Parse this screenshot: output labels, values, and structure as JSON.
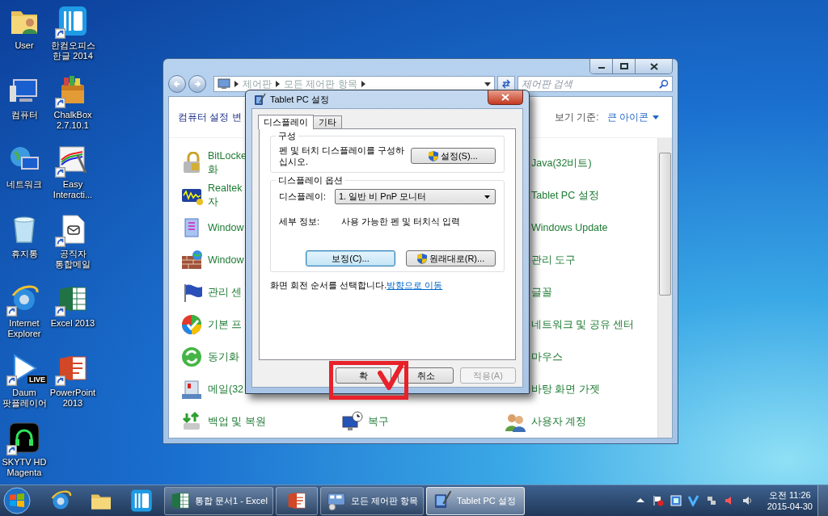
{
  "desktop_icons": [
    {
      "label": "User",
      "shortcut": false
    },
    {
      "label": "컴퓨터",
      "shortcut": false
    },
    {
      "label": "네트워크",
      "shortcut": false
    },
    {
      "label": "휴지통",
      "shortcut": false
    },
    {
      "label": "Internet Explorer",
      "shortcut": true
    },
    {
      "label": "Daum 팟플레이어",
      "shortcut": true,
      "badge": "LIVE"
    },
    {
      "label": "SKYTV HD Magenta",
      "shortcut": true
    },
    {
      "label": "한컴오피스 한글 2014",
      "shortcut": true
    },
    {
      "label": "ChalkBox 2.7.10.1",
      "shortcut": true
    },
    {
      "label": "Easy Interacti...",
      "shortcut": true
    },
    {
      "label": "공직자 통합메일",
      "shortcut": true
    },
    {
      "label": "Excel 2013",
      "shortcut": true
    },
    {
      "label": "PowerPoint 2013",
      "shortcut": true
    }
  ],
  "control_panel": {
    "breadcrumb": [
      "제어판",
      "모든 제어판 항목"
    ],
    "search": {
      "placeholder": "제어판 검색"
    },
    "heading": "컴퓨터 설정 변",
    "view_label": "보기 기준:",
    "view_value": "큰 아이콘",
    "rows": [
      {
        "left": "BitLocke\n화",
        "right": "Java(32비트)"
      },
      {
        "left": "Realtek\n자",
        "right": "Tablet PC 설정"
      },
      {
        "left": "Window",
        "right": "Windows Update"
      },
      {
        "left": "Window",
        "right": "관리 도구"
      },
      {
        "left": "관리 센",
        "right": "글꼴"
      },
      {
        "left": "기본 프",
        "right": "네트워크 및 공유 센터"
      },
      {
        "left": "동기화",
        "right": "마우스"
      },
      {
        "left": "메일(32",
        "right": "바탕 화면 가젯"
      },
      {
        "left": "백업 및 복원",
        "middle": "복구",
        "right": "사용자 계정"
      }
    ]
  },
  "dialog": {
    "title": "Tablet PC 설정",
    "tabs": [
      {
        "label": "디스플레이",
        "selected": true
      },
      {
        "label": "기타",
        "selected": false
      }
    ],
    "config_group": {
      "title": "구성",
      "text": "펜 및 터치 디스플레이를 구성하십시오.",
      "button": {
        "label": "설정(S)...",
        "shield": true
      }
    },
    "display_group": {
      "title": "디스플레이 옵션",
      "display_label": "디스플레이:",
      "display_value": "1. 일반 비 PnP 모니터",
      "details_label": "세부 정보:",
      "details_value": "사용 가능한 펜 및 터치식 입력",
      "buttons": [
        {
          "label": "보정(C)...",
          "shield": false,
          "focused": true
        },
        {
          "label": "원래대로(R)...",
          "shield": true,
          "focused": false
        }
      ]
    },
    "note": {
      "text": "화면 회전 순서를 선택합니다.",
      "link": "방향으로 이동"
    },
    "buttons": [
      {
        "label": "확",
        "disabled": false
      },
      {
        "label": "취소",
        "disabled": false
      },
      {
        "label": "적용(A)",
        "disabled": true
      }
    ]
  },
  "taskbar": {
    "tasks": [
      {
        "label": "통합 문서1 - Excel",
        "selected": false
      },
      {
        "selected": false
      },
      {
        "label": "모든 제어판 항목",
        "selected": false
      },
      {
        "label": "Tablet PC 설정",
        "selected": true
      }
    ],
    "clock": {
      "time": "오전 11:26",
      "date": "2015-04-30"
    }
  }
}
